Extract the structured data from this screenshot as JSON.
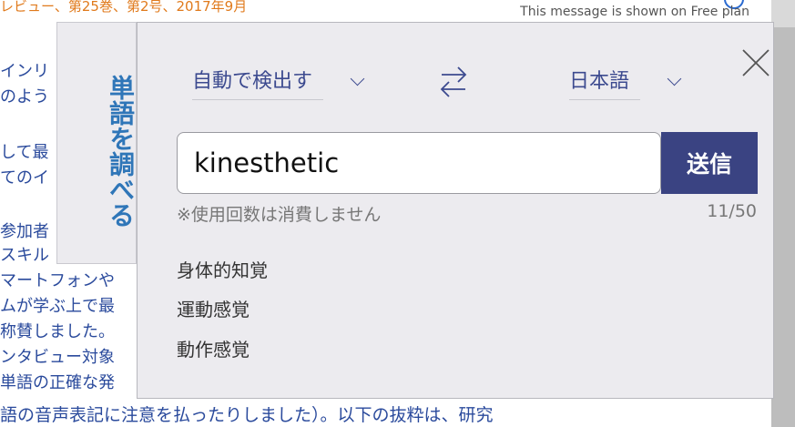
{
  "background": {
    "header": "レビュー、第25巻、第2号、2017年9月",
    "free_plan_notice": "This message is shown on Free plan",
    "lines": [
      "インリ",
      "のよう",
      "",
      "して最",
      "てのイ",
      "",
      "参加者",
      "スキル",
      "マートフォンや",
      "ムが学ぶ上で最",
      "称賛しました。",
      "ンタビュー対象",
      "単語の正確な発"
    ],
    "bottom_line": "語の音声表記に注意を払ったりしました）。以下の抜粋は、研究"
  },
  "side_tab": {
    "label": "単語を調べる"
  },
  "panel": {
    "source_language": "自動で検出す",
    "target_language": "日本語",
    "search": {
      "value": "kinesthetic",
      "placeholder": ""
    },
    "send_label": "送信",
    "note": "※使用回数は消費しません",
    "usage_counter": "11/50",
    "results": [
      "身体的知覚",
      "運動感覚",
      "動作感覚"
    ]
  },
  "colors": {
    "accent": "#3a4382",
    "link_blue": "#2a4a9c",
    "tab_blue": "#2f76b8",
    "header_orange": "#e07a1c",
    "panel_bg": "#ecebef"
  }
}
